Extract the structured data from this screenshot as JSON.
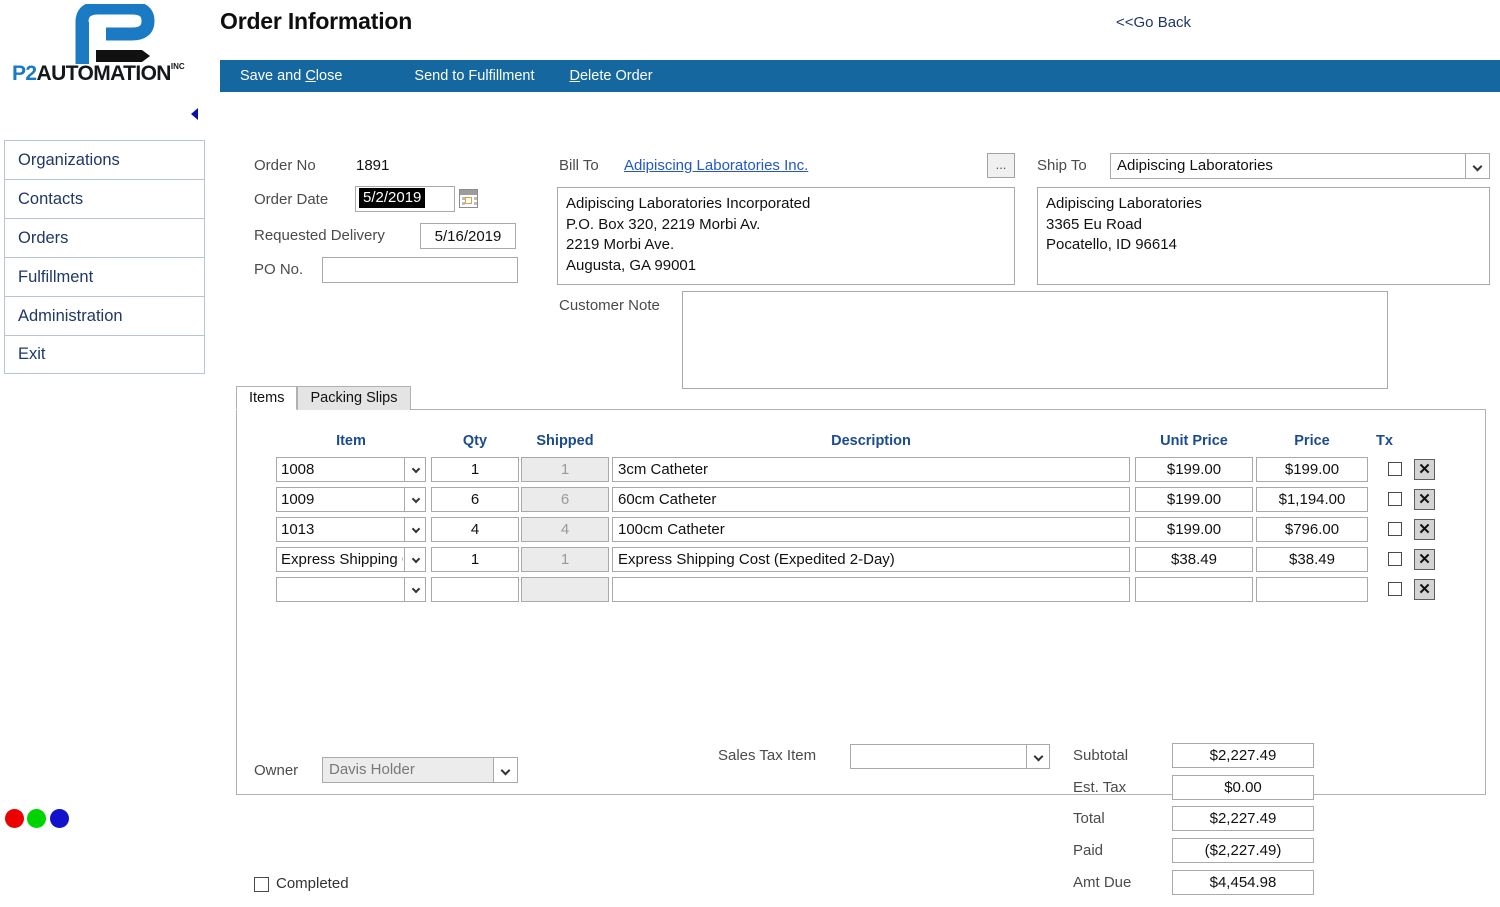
{
  "brand": {
    "name_part1": "P2",
    "name_part2": "AUTOMATION",
    "suffix": "INC"
  },
  "header": {
    "title": "Order Information",
    "go_back": "<<Go Back"
  },
  "toolbar": {
    "save_and_close": "Save and Close",
    "send_to_fulfillment": "Send to Fulfillment",
    "delete_order": "Delete Order"
  },
  "sidebar": {
    "items": [
      {
        "label": "Organizations"
      },
      {
        "label": "Contacts"
      },
      {
        "label": "Orders"
      },
      {
        "label": "Fulfillment"
      },
      {
        "label": "Administration"
      },
      {
        "label": "Exit"
      }
    ]
  },
  "order": {
    "order_no_label": "Order No",
    "order_no_value": "1891",
    "order_date_label": "Order Date",
    "order_date_value": "5/2/2019",
    "requested_delivery_label": "Requested Delivery",
    "requested_delivery_value": "5/16/2019",
    "po_no_label": "PO No.",
    "po_no_value": "",
    "po_no_placeholder": ""
  },
  "bill_to": {
    "label": "Bill To",
    "link": "Adipiscing Laboratories Inc.",
    "browse_button": "...",
    "address": "Adipiscing Laboratories Incorporated\nP.O. Box 320, 2219 Morbi Av.\n2219 Morbi Ave.\nAugusta, GA 99001"
  },
  "ship_to": {
    "label": "Ship To",
    "selected": "Adipiscing Laboratories",
    "address": "Adipiscing Laboratories\n3365 Eu Road\nPocatello, ID 96614"
  },
  "customer_note": {
    "label": "Customer Note",
    "value": "",
    "placeholder": ""
  },
  "tabs": [
    {
      "label": "Items",
      "active": true
    },
    {
      "label": "Packing Slips",
      "active": false
    }
  ],
  "items_grid": {
    "columns": {
      "item": "Item",
      "qty": "Qty",
      "shipped": "Shipped",
      "description": "Description",
      "unit_price": "Unit Price",
      "price": "Price",
      "tx": "Tx"
    },
    "delete_glyph": "✕",
    "rows": [
      {
        "item": "1008",
        "qty": "1",
        "shipped": "1",
        "description": "3cm Catheter",
        "unit_price": "$199.00",
        "price": "$199.00",
        "tx": false
      },
      {
        "item": "1009",
        "qty": "6",
        "shipped": "6",
        "description": "60cm Catheter",
        "unit_price": "$199.00",
        "price": "$1,194.00",
        "tx": false
      },
      {
        "item": "1013",
        "qty": "4",
        "shipped": "4",
        "description": "100cm Catheter",
        "unit_price": "$199.00",
        "price": "$796.00",
        "tx": false
      },
      {
        "item": "Express Shipping Cost",
        "qty": "1",
        "shipped": "1",
        "description": "Express Shipping Cost (Expedited 2-Day)",
        "unit_price": "$38.49",
        "price": "$38.49",
        "tx": false
      },
      {
        "item": "",
        "qty": "",
        "shipped": "",
        "description": "",
        "unit_price": "",
        "price": "",
        "tx": false
      }
    ]
  },
  "footer": {
    "owner_label": "Owner",
    "owner_value": "Davis Holder",
    "sales_tax_item_label": "Sales Tax Item",
    "sales_tax_item_value": "",
    "completed_label": "Completed",
    "completed_checked": false,
    "totals": [
      {
        "label": "Subtotal",
        "value": "$2,227.49"
      },
      {
        "label": "Est. Tax",
        "value": "$0.00"
      },
      {
        "label": "Total",
        "value": "$2,227.49"
      },
      {
        "label": "Paid",
        "value": "($2,227.49)"
      },
      {
        "label": "Amt Due",
        "value": "$4,454.98"
      }
    ]
  },
  "status_dots": [
    {
      "name": "red",
      "color": "#ee0000"
    },
    {
      "name": "green",
      "color": "#00d400"
    },
    {
      "name": "blue",
      "color": "#1212cc"
    }
  ],
  "colors": {
    "toolbar_blue": "#15679f",
    "link_blue": "#2457c5",
    "sidebar_text": "#1f3864",
    "grid_header": "#1b4b8f"
  }
}
